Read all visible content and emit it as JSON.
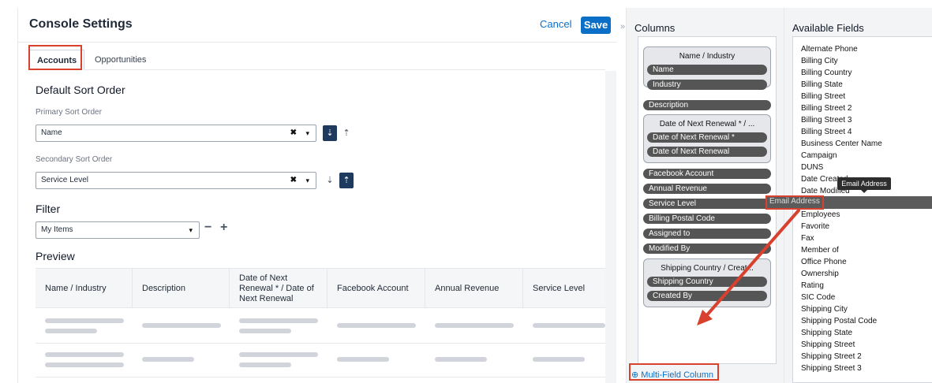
{
  "header": {
    "title": "Console Settings",
    "cancel_label": "Cancel",
    "save_label": "Save",
    "collapse_glyph": "»"
  },
  "tabs": [
    {
      "label": "Accounts"
    },
    {
      "label": "Opportunities"
    }
  ],
  "sort": {
    "heading": "Default Sort Order",
    "primary_label": "Primary Sort Order",
    "primary_value": "Name",
    "secondary_label": "Secondary Sort Order",
    "secondary_value": "Service Level",
    "clear_glyph": "✖",
    "caret_glyph": "▾",
    "desc_glyph": "⇣",
    "asc_glyph": "⇡"
  },
  "filter": {
    "heading": "Filter",
    "value": "My Items",
    "minus": "−",
    "plus": "+"
  },
  "preview": {
    "heading": "Preview",
    "columns": [
      "Name / Industry",
      "Description",
      "Date of Next Renewal * / Date of Next Renewal",
      "Facebook Account",
      "Annual Revenue",
      "Service Level"
    ]
  },
  "columns_panel": {
    "heading": "Columns",
    "groups": [
      {
        "title": "Name / Industry",
        "items": [
          "Name",
          "Industry"
        ]
      },
      {
        "title": "Date of Next Renewal * / ...",
        "items": [
          "Date of Next Renewal *",
          "Date of Next Renewal"
        ]
      },
      {
        "title": "Shipping Country / Creat...",
        "items": [
          "Shipping Country",
          "Created By"
        ]
      }
    ],
    "singles": [
      "Description",
      "Facebook Account",
      "Annual Revenue",
      "Service Level",
      "Billing Postal Code",
      "Assigned to",
      "Modified By"
    ],
    "multi_field": "Multi-Field Column",
    "multi_icon": "⊕"
  },
  "available_fields": {
    "heading": "Available Fields",
    "items": [
      "Alternate Phone",
      "Billing City",
      "Billing Country",
      "Billing State",
      "Billing Street",
      "Billing Street 2",
      "Billing Street 3",
      "Billing Street 4",
      "Business Center Name",
      "Campaign",
      "DUNS",
      "Date Created",
      "Date Modified",
      "",
      "Employees",
      "Favorite",
      "Fax",
      "Member of",
      "Office Phone",
      "Ownership",
      "Rating",
      "SIC Code",
      "Shipping City",
      "Shipping Postal Code",
      "Shipping State",
      "Shipping Street",
      "Shipping Street 2",
      "Shipping Street 3"
    ]
  },
  "drag": {
    "ghost_label": "Email Address",
    "tooltip": "Email Address"
  },
  "colors": {
    "accent": "#0b6fc7",
    "highlight": "#d9412f",
    "pill": "#555555"
  }
}
